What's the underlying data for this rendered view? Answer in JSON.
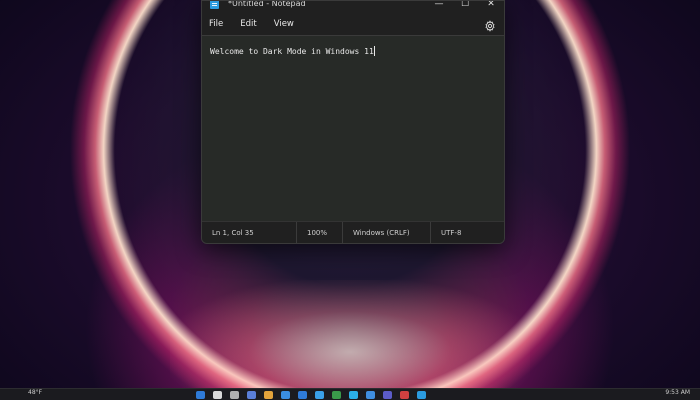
{
  "window": {
    "title": "*Untitled - Notepad",
    "controls": {
      "minimize": "—",
      "maximize": "☐",
      "close": "✕"
    }
  },
  "menu": {
    "items": [
      "File",
      "Edit",
      "View"
    ],
    "settings_icon": "gear-icon"
  },
  "editor": {
    "text": "Welcome to Dark Mode in Windows 11"
  },
  "status": {
    "position": "Ln 1, Col 35",
    "zoom": "100%",
    "line_ending": "Windows (CRLF)",
    "encoding": "UTF-8"
  },
  "taskbar": {
    "weather": "48°F",
    "clock": "9:53 AM",
    "icon_colors": [
      "#2f7bd8",
      "#d9d9d9",
      "#b0b0b0",
      "#5a7fd8",
      "#e2a33b",
      "#3a8de0",
      "#2f7bd8",
      "#3aa0e8",
      "#3a9a4a",
      "#2bb0e8",
      "#3f8ee0",
      "#5c5cc8",
      "#d04040",
      "#2b9be0"
    ]
  },
  "colors": {
    "window_bg": "#272727",
    "editor_bg": "#272a27",
    "text": "#e8e8e8"
  }
}
